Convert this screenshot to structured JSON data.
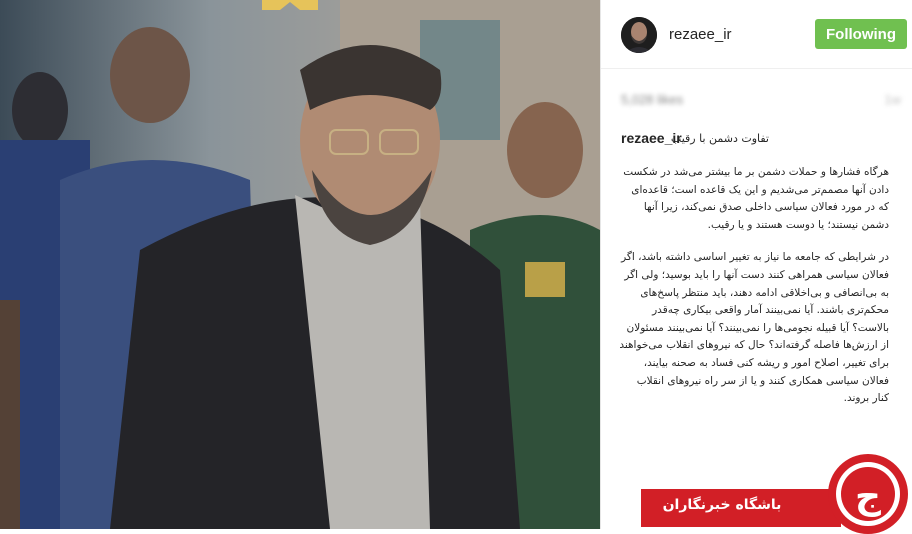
{
  "header": {
    "username": "rezaee_ir",
    "follow_label": "Following"
  },
  "meta": {
    "likes": "5,028 likes",
    "time": "1w"
  },
  "caption": {
    "username": "rezaee_ir",
    "title": "تفاوت دشمن با رقیب",
    "paragraphs": [
      "هرگاه فشارها و حملات دشمن بر ما بیشتر می‌شد در شکست دادن آنها مصمم‌تر می‌شدیم و این یک قاعده است؛ قاعده‌ای که در مورد فعالان سیاسی داخلی صدق نمی‌کند، زیرا آنها دشمن نیستند؛ یا دوست هستند و یا رقیب.",
      "در شرایطی که جامعه ما نیاز به تغییر اساسی داشته باشد، اگر فعالان سیاسی همراهی کنند دست آنها را باید بوسید؛ ولی اگر به بی‌انصافی و بی‌اخلاقی ادامه دهند، باید منتظر پاسخ‌های محکم‌تری باشند. آیا نمی‌بینند آمار واقعی بیکاری چه‌قدر بالاست؟ آیا قبیله نجومی‌ها را نمی‌بینند؟ آیا نمی‌بینند مسئولان از ارزش‌ها فاصله گرفته‌اند؟ حال که نیروهای انقلاب می‌خواهند برای تغییر، اصلاح امور و ریشه کنی فساد به صحنه بیایند، فعالان سیاسی همکاری کنند و یا از سر راه نیروهای انقلاب کنار بروند."
    ]
  },
  "watermark": {
    "text": "باشگاه خبرنگاران",
    "logo_letter": "ج"
  },
  "colors": {
    "follow_bg": "#70c050",
    "watermark_red": "#d21f26"
  }
}
